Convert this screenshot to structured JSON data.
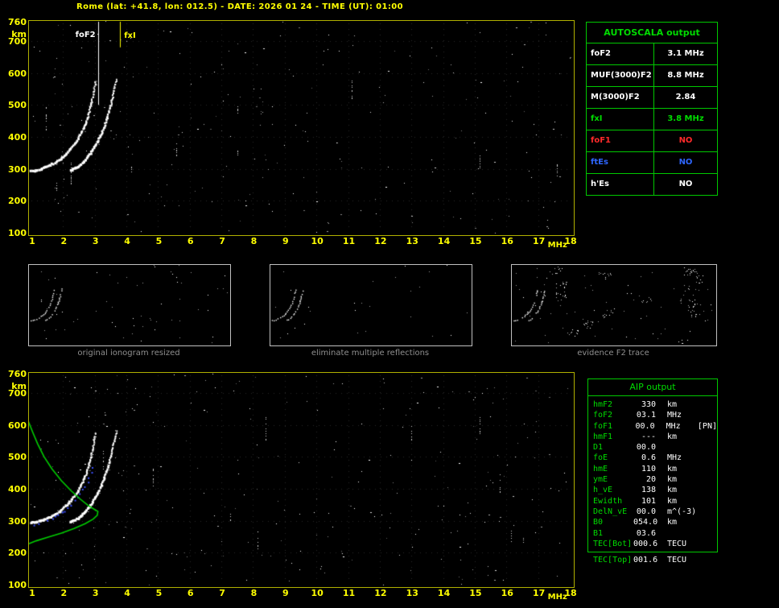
{
  "title": "Rome (lat: +41.8, lon: 012.5) - DATE: 2026 01 24 - TIME (UT): 01:00",
  "colors": {
    "axis": "#ffff00",
    "table_border": "#00c800",
    "table_green": "#00dc00",
    "value_white": "#ffffff",
    "no_red": "#ff2a2a",
    "no_blue": "#2e66ff",
    "caption_gray": "#8f8f8f"
  },
  "autoscala": {
    "title": "AUTOSCALA output",
    "rows": [
      {
        "label": "foF2",
        "value": "3.1 MHz",
        "color": "white"
      },
      {
        "label": "MUF(3000)F2",
        "value": "8.8 MHz",
        "color": "white"
      },
      {
        "label": "M(3000)F2",
        "value": "2.84",
        "color": "white"
      },
      {
        "label": "fxI",
        "value": "3.8 MHz",
        "color": "green"
      },
      {
        "label": "foF1",
        "value": "NO",
        "color": "red"
      },
      {
        "label": "ftEs",
        "value": "NO",
        "color": "blue"
      },
      {
        "label": "h'Es",
        "value": "NO",
        "color": "white"
      }
    ]
  },
  "thumbnails": [
    {
      "caption": "original ionogram resized"
    },
    {
      "caption": "eliminate multiple reflections"
    },
    {
      "caption": "evidence F2 trace"
    }
  ],
  "aip": {
    "title": "AIP output",
    "rows": [
      {
        "label": "hmF2",
        "value": "330",
        "unit": "km",
        "note": ""
      },
      {
        "label": "foF2",
        "value": "03.1",
        "unit": "MHz",
        "note": ""
      },
      {
        "label": "foF1",
        "value": "00.0",
        "unit": "MHz",
        "note": "[PN]"
      },
      {
        "label": "hmF1",
        "value": "---",
        "unit": "km",
        "note": ""
      },
      {
        "label": "D1",
        "value": "00.0",
        "unit": "",
        "note": ""
      },
      {
        "label": "foE",
        "value": "0.6",
        "unit": "MHz",
        "note": ""
      },
      {
        "label": "hmE",
        "value": "110",
        "unit": "km",
        "note": ""
      },
      {
        "label": "ymE",
        "value": "20",
        "unit": "km",
        "note": ""
      },
      {
        "label": "h_vE",
        "value": "138",
        "unit": "km",
        "note": ""
      },
      {
        "label": "Ewidth",
        "value": "101",
        "unit": "km",
        "note": ""
      },
      {
        "label": "DelN_vE",
        "value": "00.0",
        "unit": "m^(-3)",
        "note": ""
      },
      {
        "label": "B0",
        "value": "054.0",
        "unit": "km",
        "note": ""
      },
      {
        "label": "B1",
        "value": "03.6",
        "unit": "",
        "note": ""
      },
      {
        "label": "TEC[Bot]",
        "value": "000.6",
        "unit": "TECU",
        "note": ""
      }
    ],
    "below_row": {
      "label": "TEC[Top]",
      "value": "001.6",
      "unit": "TECU",
      "note": ""
    }
  },
  "chart_data": [
    {
      "id": "ionogram-scaled",
      "type": "scatter",
      "title": "",
      "xlabel": "MHz",
      "ylabel": "km",
      "xlim": [
        1,
        18
      ],
      "ylim": [
        100,
        760
      ],
      "x_ticks": [
        1,
        2,
        3,
        4,
        5,
        6,
        7,
        8,
        9,
        10,
        11,
        12,
        13,
        14,
        15,
        16,
        17,
        18
      ],
      "y_ticks": [
        760,
        700,
        600,
        500,
        400,
        300,
        200,
        100
      ],
      "grid": true,
      "series": [
        {
          "name": "F2-trace-ordinary",
          "style": "trace",
          "color": "#ffffff",
          "points": [
            [
              1.0,
              292
            ],
            [
              1.15,
              295
            ],
            [
              1.3,
              299
            ],
            [
              1.5,
              306
            ],
            [
              1.7,
              316
            ],
            [
              1.9,
              329
            ],
            [
              2.1,
              346
            ],
            [
              2.3,
              368
            ],
            [
              2.5,
              396
            ],
            [
              2.65,
              426
            ],
            [
              2.78,
              460
            ],
            [
              2.88,
              496
            ],
            [
              2.95,
              530
            ],
            [
              3.0,
              556
            ],
            [
              3.04,
              578
            ]
          ]
        },
        {
          "name": "F2-trace-extraordinary",
          "style": "trace",
          "color": "#ffffff",
          "points": [
            [
              2.25,
              295
            ],
            [
              2.4,
              302
            ],
            [
              2.55,
              312
            ],
            [
              2.7,
              326
            ],
            [
              2.85,
              344
            ],
            [
              3.0,
              367
            ],
            [
              3.15,
              396
            ],
            [
              3.3,
              430
            ],
            [
              3.42,
              466
            ],
            [
              3.52,
              503
            ],
            [
              3.6,
              538
            ],
            [
              3.66,
              566
            ],
            [
              3.7,
              583
            ]
          ]
        }
      ],
      "markers": [
        {
          "name": "foF2-line",
          "label": "foF2",
          "freq": 3.1,
          "to_km": 500,
          "color": "#ffffff"
        },
        {
          "name": "fxI-line",
          "label": "fxI",
          "freq": 3.8,
          "to_km": 680,
          "color": "#ffff00"
        }
      ]
    },
    {
      "id": "ionogram-with-profile",
      "type": "scatter",
      "title": "",
      "xlabel": "MHz",
      "ylabel": "km",
      "xlim": [
        1,
        18
      ],
      "ylim": [
        100,
        760
      ],
      "x_ticks": [
        1,
        2,
        3,
        4,
        5,
        6,
        7,
        8,
        9,
        10,
        11,
        12,
        13,
        14,
        15,
        16,
        17,
        18
      ],
      "y_ticks": [
        760,
        700,
        600,
        500,
        400,
        300,
        200,
        100
      ],
      "grid": true,
      "series": [
        {
          "name": "F2-trace-ordinary",
          "style": "trace",
          "color": "#ffffff",
          "points": [
            [
              1.0,
              292
            ],
            [
              1.15,
              295
            ],
            [
              1.3,
              299
            ],
            [
              1.5,
              306
            ],
            [
              1.7,
              316
            ],
            [
              1.9,
              329
            ],
            [
              2.1,
              346
            ],
            [
              2.3,
              368
            ],
            [
              2.5,
              396
            ],
            [
              2.65,
              426
            ],
            [
              2.78,
              460
            ],
            [
              2.88,
              496
            ],
            [
              2.95,
              530
            ],
            [
              3.0,
              556
            ],
            [
              3.04,
              578
            ]
          ]
        },
        {
          "name": "F2-trace-extraordinary",
          "style": "trace",
          "color": "#ffffff",
          "points": [
            [
              2.25,
              295
            ],
            [
              2.4,
              302
            ],
            [
              2.55,
              312
            ],
            [
              2.7,
              326
            ],
            [
              2.85,
              344
            ],
            [
              3.0,
              367
            ],
            [
              3.15,
              396
            ],
            [
              3.3,
              430
            ],
            [
              3.42,
              466
            ],
            [
              3.52,
              503
            ],
            [
              3.6,
              538
            ],
            [
              3.66,
              566
            ],
            [
              3.7,
              583
            ]
          ]
        },
        {
          "name": "restored-trace-points",
          "style": "dots",
          "color": "#3c50ff",
          "points": [
            [
              1.05,
              287
            ],
            [
              1.25,
              292
            ],
            [
              1.45,
              299
            ],
            [
              1.65,
              308
            ],
            [
              1.85,
              319
            ],
            [
              2.05,
              333
            ],
            [
              2.25,
              351
            ],
            [
              2.45,
              374
            ],
            [
              2.6,
              397
            ],
            [
              2.75,
              424
            ],
            [
              2.87,
              453
            ],
            [
              2.95,
              478
            ]
          ]
        },
        {
          "name": "electron-density-profile",
          "style": "line",
          "color": "#00cc00",
          "points": [
            [
              0.9,
              612
            ],
            [
              1.05,
              575
            ],
            [
              1.2,
              540
            ],
            [
              1.4,
              500
            ],
            [
              1.65,
              462
            ],
            [
              1.95,
              425
            ],
            [
              2.25,
              394
            ],
            [
              2.55,
              367
            ],
            [
              2.8,
              347
            ],
            [
              3.0,
              335
            ],
            [
              3.1,
              329
            ],
            [
              3.08,
              317
            ],
            [
              2.95,
              305
            ],
            [
              2.7,
              291
            ],
            [
              2.35,
              276
            ],
            [
              1.95,
              261
            ],
            [
              1.55,
              249
            ],
            [
              1.15,
              237
            ],
            [
              0.85,
              225
            ],
            [
              0.68,
              212
            ],
            [
              0.58,
              198
            ],
            [
              0.53,
              184
            ],
            [
              0.55,
              168
            ],
            [
              0.62,
              150
            ],
            [
              0.66,
              138
            ]
          ]
        }
      ],
      "markers": []
    }
  ]
}
